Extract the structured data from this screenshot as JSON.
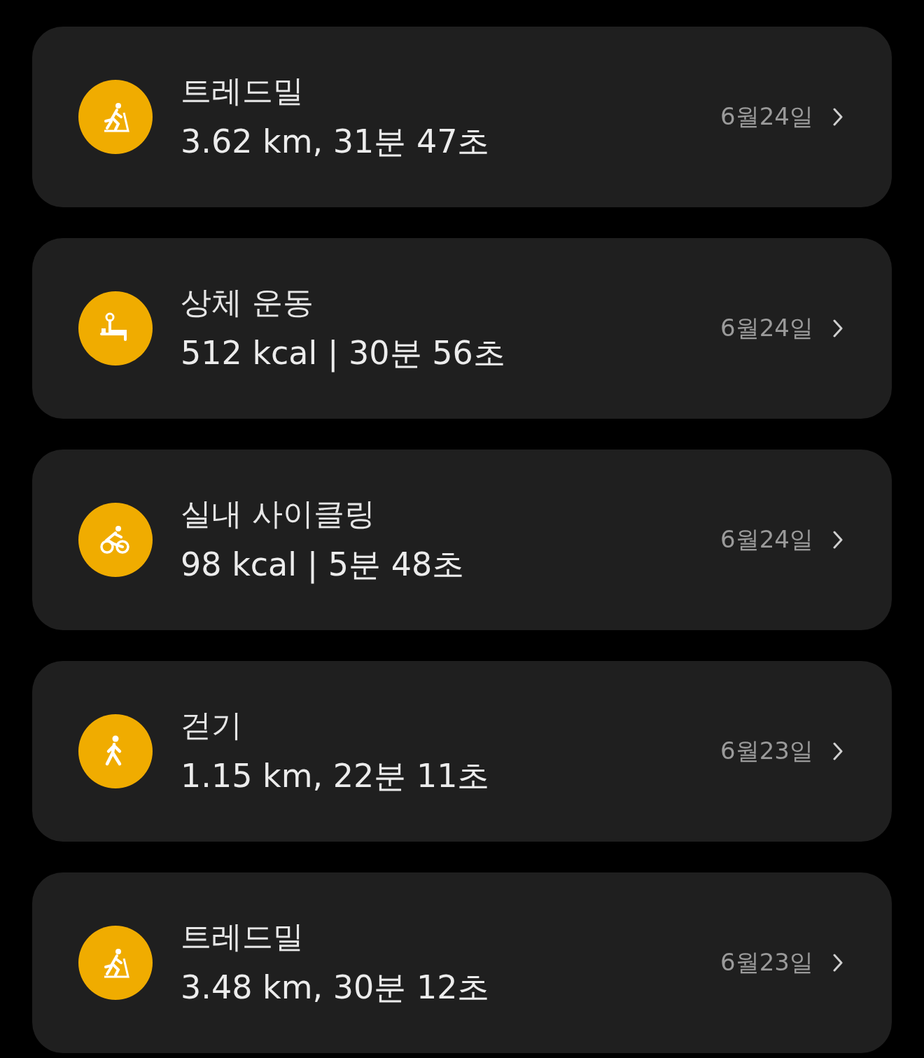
{
  "workouts": [
    {
      "kind": "treadmill",
      "title": "트레드밀",
      "detail": "3.62 km, 31분 47초",
      "date": "6월24일"
    },
    {
      "kind": "weights",
      "title": "상체 운동",
      "detail": "512 kcal | 30분 56초",
      "date": "6월24일"
    },
    {
      "kind": "cycling",
      "title": "실내 사이클링",
      "detail": "98 kcal | 5분 48초",
      "date": "6월24일"
    },
    {
      "kind": "walking",
      "title": "걷기",
      "detail": "1.15 km, 22분 11초",
      "date": "6월23일"
    },
    {
      "kind": "treadmill",
      "title": "트레드밀",
      "detail": "3.48 km, 30분 12초",
      "date": "6월23일"
    }
  ]
}
